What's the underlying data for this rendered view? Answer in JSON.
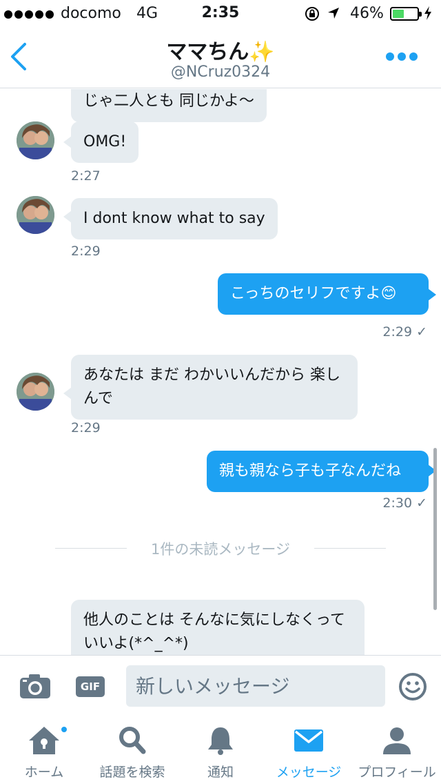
{
  "status_bar": {
    "carrier": "docomo",
    "network": "4G",
    "time": "2:35",
    "battery_percent": "46%",
    "battery_level": 0.46,
    "colors": {
      "battery_fill": "#4cd964"
    }
  },
  "header": {
    "name": "ママちん✨",
    "handle": "@NCruz0324"
  },
  "messages": [
    {
      "from": "them",
      "text": "じゃ二人とも 同じかよ〜"
    },
    {
      "from": "them",
      "text": "OMG!",
      "time": "2:27"
    },
    {
      "from": "them",
      "text": "I dont know what to say",
      "time": "2:29"
    },
    {
      "from": "me",
      "text": "こっちのセリフですよ😊",
      "time": "2:29"
    },
    {
      "from": "them",
      "text": "あなたは まだ わかいいんだから 楽しんで",
      "time": "2:29"
    },
    {
      "from": "me",
      "text": "親も親なら子も子なんだね",
      "time": "2:30"
    },
    {
      "from": "them",
      "text": "他人のことは そんなに気にしなくっていいよ(*^_^*)"
    }
  ],
  "read_mark": "✓",
  "unread_divider": "1件の未読メッセージ",
  "composer": {
    "gif_label": "GIF",
    "placeholder": "新しいメッセージ"
  },
  "tabs": [
    {
      "label": "ホーム",
      "icon": "home-icon",
      "active": false,
      "has_dot": true
    },
    {
      "label": "話題を検索",
      "icon": "search-icon",
      "active": false
    },
    {
      "label": "通知",
      "icon": "bell-icon",
      "active": false
    },
    {
      "label": "メッセージ",
      "icon": "envelope-icon",
      "active": true
    },
    {
      "label": "プロフィール",
      "icon": "person-icon",
      "active": false
    }
  ],
  "colors": {
    "accent": "#1da1f2",
    "incoming_bubble": "#e6ecf0",
    "secondary_text": "#657786"
  }
}
